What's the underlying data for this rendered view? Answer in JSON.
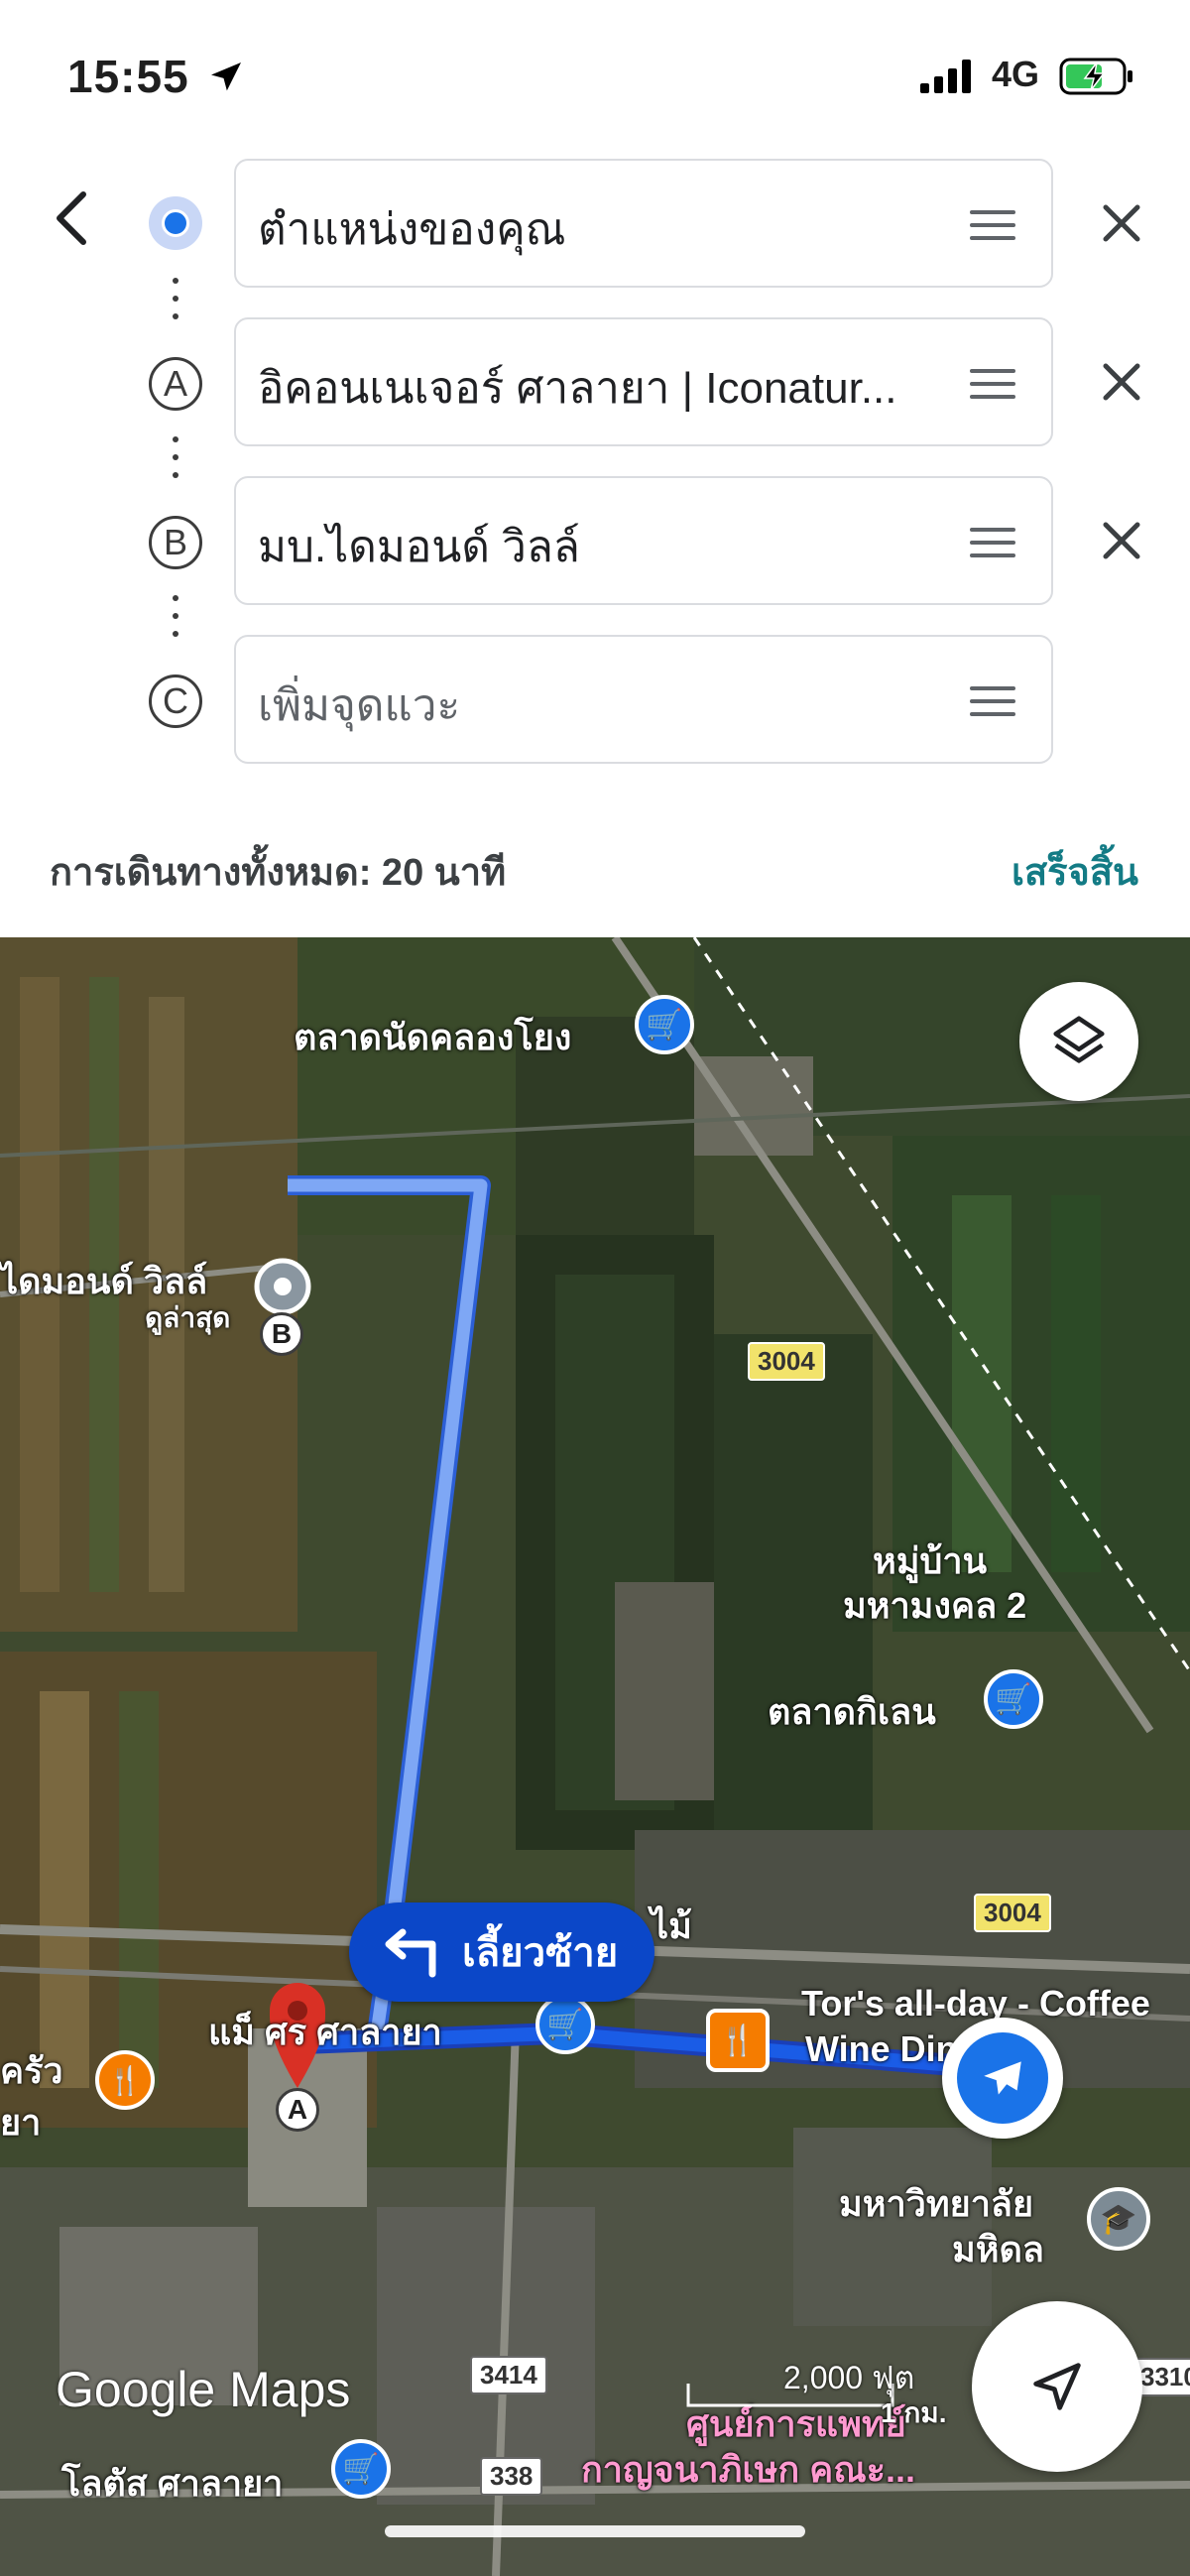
{
  "status_bar": {
    "time": "15:55",
    "network": "4G"
  },
  "directions": {
    "stops": [
      {
        "marker": "",
        "text": "ตำแหน่งของคุณ",
        "placeholder": false
      },
      {
        "marker": "A",
        "text": "อิคอนเนเจอร์ ศาลายา | Iconatur...",
        "placeholder": false
      },
      {
        "marker": "B",
        "text": "มบ.ไดมอนด์ วิลล์",
        "placeholder": false
      },
      {
        "marker": "C",
        "text": "เพิ่มจุดแวะ",
        "placeholder": true
      }
    ],
    "summary": "การเดินทางทั้งหมด: 20 นาที",
    "done_label": "เสร็จสิ้น"
  },
  "map": {
    "labels": {
      "market_khlong_yong": "ตลาดนัดคลองโยง",
      "diamond_ville": "ไดมอนด์ วิลล์",
      "latest": "ดูล่าสุด",
      "village_line1": "หมู่บ้าน",
      "village_line2": "มหามงคล 2",
      "market_kilen": "ตลาดกิเลน",
      "mai": "ไม้",
      "salaya_partial": "แม็ ศร ศาลายา",
      "tors_line1": "Tor's all-day - Coffee",
      "tors_line2": "Wine Din",
      "khrua": "ครัว",
      "ya": "ยา",
      "mahidol_line1": "มหาวิทยาลัย",
      "mahidol_line2": "มหิดล",
      "lotus": "โลตัส ศาลายา",
      "hospital_line1": "ศูนย์การแพทย์",
      "hospital_line2": "กาญจนาภิเษก คณะ...",
      "km": "1 กม."
    },
    "roads": [
      "3004",
      "3004",
      "3414",
      "338",
      "3310"
    ],
    "turn_instruction": "เลี้ยวซ้าย",
    "scale": "2,000 ฟุต",
    "logo": "Google Maps",
    "colors": {
      "route": "#1a5ce6",
      "route_light": "#7ea7f5",
      "accent_done": "#137b85",
      "pin_red": "#d93025"
    }
  }
}
